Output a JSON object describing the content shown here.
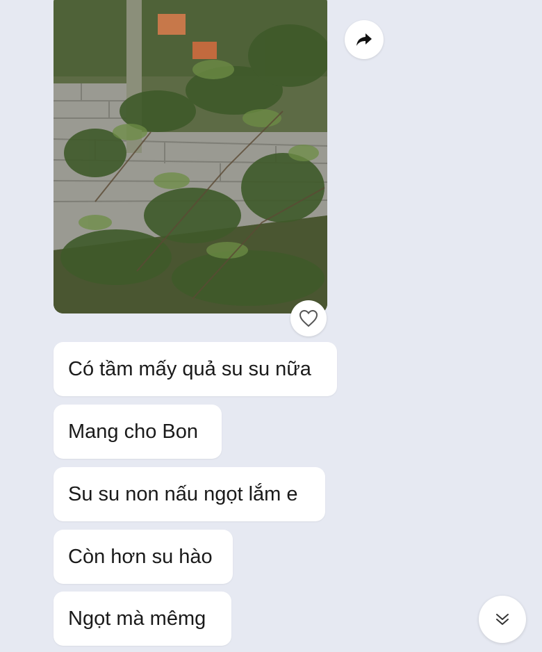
{
  "photo": {
    "description_icon": "garden-photo"
  },
  "actions": {
    "forward_icon": "forward-arrow-icon",
    "react_icon": "heart-icon",
    "scroll_icon": "double-chevron-down-icon"
  },
  "messages": [
    {
      "text": "Có tầm mấy quả su su nữa"
    },
    {
      "text": "Mang cho Bon"
    },
    {
      "text": "Su su non nấu ngọt lắm e"
    },
    {
      "text": "Còn hơn su hào"
    },
    {
      "text": "Ngọt mà mêmg"
    }
  ],
  "colors": {
    "background": "#e6e9f2",
    "bubble": "#ffffff",
    "text": "#1a1a1a"
  }
}
